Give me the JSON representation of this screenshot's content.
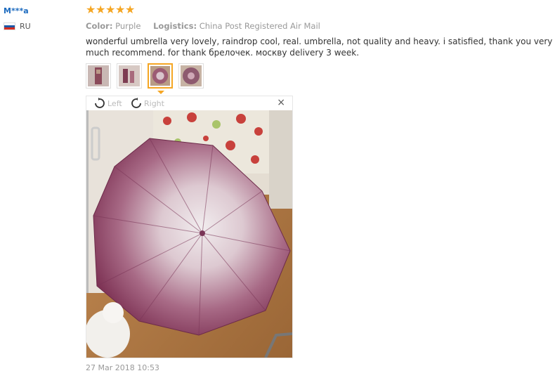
{
  "user": {
    "name": "M***a",
    "country_code": "RU",
    "flag_colors": [
      "#ffffff",
      "#1c57a5",
      "#d52b1e"
    ]
  },
  "review": {
    "rating": 5,
    "stars": [
      "★",
      "★",
      "★",
      "★",
      "★"
    ],
    "color_label": "Color:",
    "color_value": "Purple",
    "logistics_label": "Logistics:",
    "logistics_value": "China Post Registered Air Mail",
    "text": "wonderful umbrella very lovely, raindrop cool, real. umbrella, not quality and heavy. i satisfied, thank you very much recommend. for thank брелочек. москву delivery 3 week.",
    "date": "27 Mar 2018 10:53"
  },
  "viewer": {
    "rotate_left_label": "Left",
    "rotate_right_label": "Right",
    "close_symbol": "×",
    "active_thumb_index": 2
  },
  "colors": {
    "accent": "#f5a623",
    "link": "#1d6bbf",
    "muted": "#999999"
  }
}
